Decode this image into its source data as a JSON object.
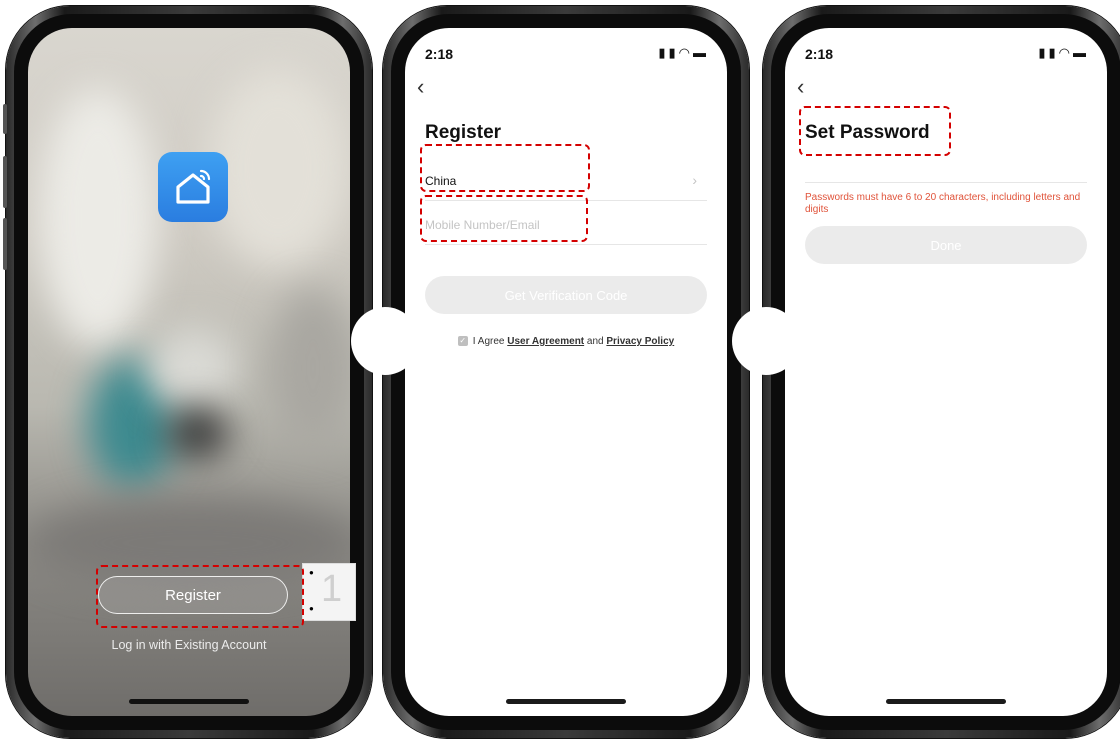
{
  "screen1": {
    "register_label": "Register",
    "login_label": "Log in with Existing Account",
    "app_icon": "smart-home-icon"
  },
  "screen2": {
    "time": "2:18",
    "title": "Register",
    "country_value": "China",
    "mobile_placeholder": "Mobile Number/Email",
    "get_code_label": "Get Verification Code",
    "agree_prefix": "I Agree",
    "user_agreement": "User Agreement",
    "and_text": "and",
    "privacy_policy": "Privacy Policy"
  },
  "screen3": {
    "time": "2:18",
    "title": "Set Password",
    "hint": "Passwords must have 6 to 20 characters, including letters and digits",
    "done_label": "Done"
  },
  "fragment_text": "1",
  "colors": {
    "highlight": "#d40000",
    "app_icon_blue": "#2a7de0",
    "hint_red": "#e0533a",
    "disabled_pill": "#ebebeb"
  }
}
